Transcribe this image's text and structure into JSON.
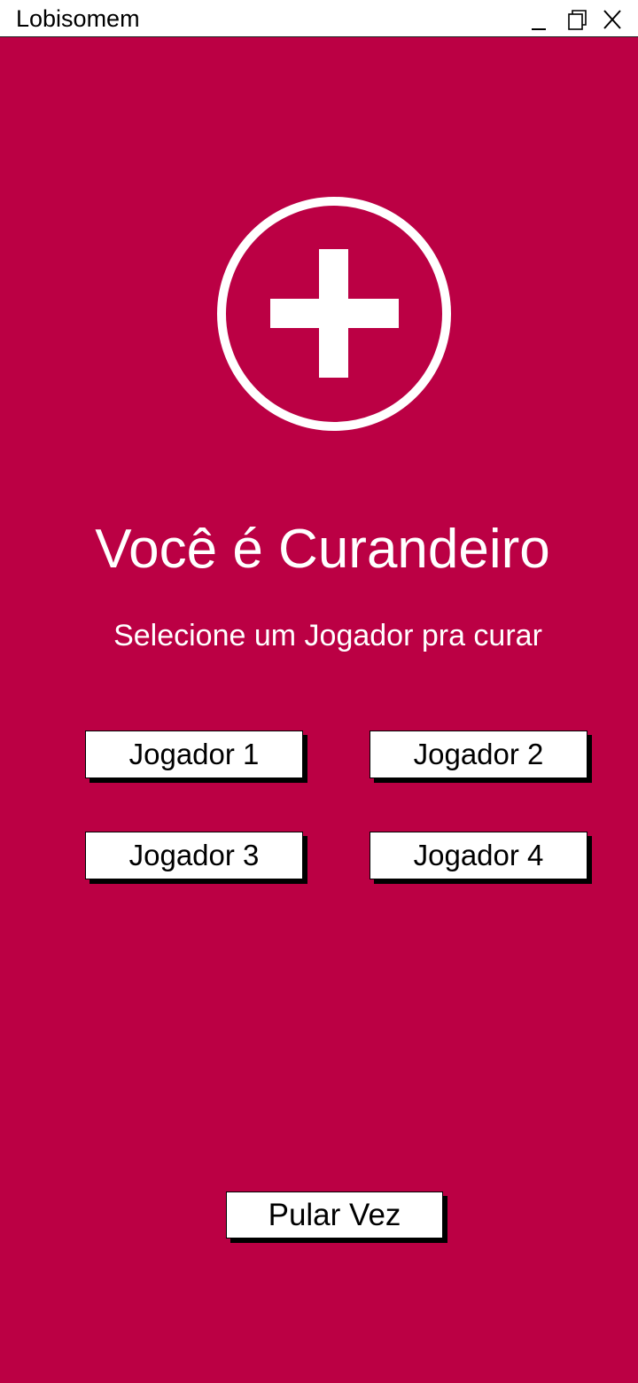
{
  "window": {
    "title": "Lobisomem",
    "controls": {
      "minimize_icon": "minimize-icon",
      "maximize_icon": "maximize-icon",
      "close_icon": "close-icon"
    }
  },
  "screen": {
    "background_color": "#bb0044",
    "role_icon": "plus-circle-icon",
    "role_title": "Você é Curandeiro",
    "instruction": "Selecione um Jogador pra curar",
    "players": [
      {
        "label": "Jogador 1"
      },
      {
        "label": "Jogador 2"
      },
      {
        "label": "Jogador 3"
      },
      {
        "label": "Jogador 4"
      }
    ],
    "skip_label": "Pular Vez"
  }
}
